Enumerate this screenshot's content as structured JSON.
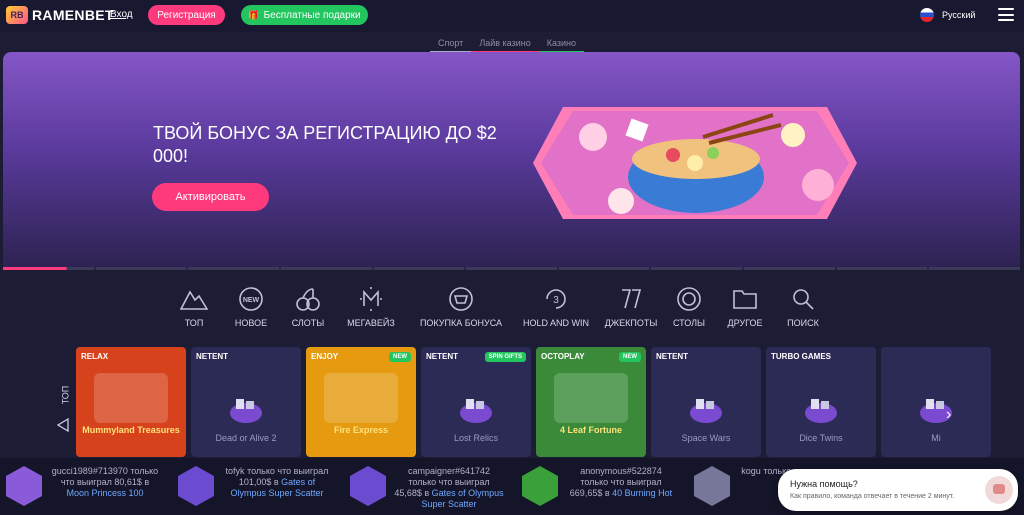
{
  "header": {
    "logo_text": "RAMENBET",
    "logo_badge": "RB",
    "login": "Вход",
    "register": "Регистрация",
    "gifts": "Бесплатные подарки",
    "language": "Русский"
  },
  "subnav": [
    "Спорт",
    "Лайв казино",
    "Казино"
  ],
  "banner": {
    "title": "ТВОЙ БОНУС ЗА РЕГИСТРАЦИЮ ДО $2 000!",
    "cta": "Активировать"
  },
  "categories": [
    {
      "label": "ТОП",
      "icon": "mountain-icon"
    },
    {
      "label": "НОВОЕ",
      "icon": "new-badge-icon"
    },
    {
      "label": "СЛОТЫ",
      "icon": "cherries-icon"
    },
    {
      "label": "МЕГАВЕЙЗ",
      "icon": "megaways-icon"
    },
    {
      "label": "ПОКУПКА БОНУСА",
      "icon": "bonus-buy-icon"
    },
    {
      "label": "HOLD AND WIN",
      "icon": "hold-and-win-icon"
    },
    {
      "label": "ДЖЕКПОТЫ",
      "icon": "jackpot-icon"
    },
    {
      "label": "СТОЛЫ",
      "icon": "chip-icon"
    },
    {
      "label": "ДРУГОЕ",
      "icon": "folder-icon"
    },
    {
      "label": "ПОИСК",
      "icon": "search-icon"
    }
  ],
  "top_label": "ТОП",
  "games": [
    {
      "provider": "RELAX",
      "name": "Mummyland Treasures",
      "tag": "",
      "bg": "#d6421c",
      "art": true
    },
    {
      "provider": "NETENT",
      "name": "Dead or Alive 2",
      "tag": "",
      "bg": "#2b2b56",
      "art": false
    },
    {
      "provider": "ENJOY",
      "name": "Fire Express",
      "tag": "NEW",
      "bg": "#e59a10",
      "art": true
    },
    {
      "provider": "NETENT",
      "name": "Lost Relics",
      "tag": "SPIN GIFTS",
      "bg": "#2b2b56",
      "art": false
    },
    {
      "provider": "OCTOPLAY",
      "name": "4 Leaf Fortune",
      "tag": "NEW",
      "bg": "#3a8a3a",
      "art": true
    },
    {
      "provider": "NETENT",
      "name": "Space Wars",
      "tag": "",
      "bg": "#2b2b56",
      "art": false
    },
    {
      "provider": "TURBO GAMES",
      "name": "Dice Twins",
      "tag": "",
      "bg": "#2b2b56",
      "art": false
    },
    {
      "provider": "",
      "name": "Mi",
      "tag": "",
      "bg": "#2b2b56",
      "art": false
    }
  ],
  "winners": [
    {
      "user": "gucci1989#713970",
      "text": "только что выиграл 80,61$ в",
      "game": "Moon Princess 100"
    },
    {
      "user": "tofyk",
      "text": "только что выиграл 101,00$ в",
      "game": "Gates of Olympus Super Scatter"
    },
    {
      "user": "campaigner#641742",
      "text": "только что выиграл 45,68$ в",
      "game": "Gates of Olympus Super Scatter"
    },
    {
      "user": "anonymous#522874",
      "text": "только что выиграл 669,65$ в",
      "game": "40 Burning Hot"
    },
    {
      "user": "kogu",
      "text": "только что выиграл 321,15",
      "game": ""
    }
  ],
  "help": {
    "title": "Нужна помощь?",
    "subtitle": "Как правило, команда отвечает в течение 2 минут."
  }
}
